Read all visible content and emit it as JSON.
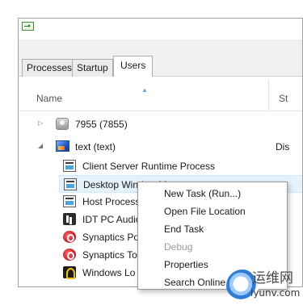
{
  "tabs": [
    {
      "label": "Processes"
    },
    {
      "label": "Startup"
    },
    {
      "label": "Users"
    }
  ],
  "columns": {
    "name": "Name",
    "status": "St"
  },
  "users": [
    {
      "label": "7955 (7855)",
      "expanded": false,
      "icon": "user-icon"
    },
    {
      "label": "text (text)",
      "expanded": true,
      "icon": "desktop-icon",
      "status": "Dis"
    }
  ],
  "processes": [
    {
      "label": "Client Server Runtime Process",
      "icon": "window-icon"
    },
    {
      "label": "Desktop Window M",
      "icon": "window-icon",
      "selected": true
    },
    {
      "label": "Host Process",
      "icon": "window-icon"
    },
    {
      "label": "IDT PC Audio",
      "icon": "audio-icon"
    },
    {
      "label": "Synaptics Po",
      "icon": "synaptics-icon"
    },
    {
      "label": "Synaptics To",
      "icon": "synaptics-icon"
    },
    {
      "label": "Windows Lo",
      "icon": "logon-icon"
    }
  ],
  "context_menu": {
    "items": [
      {
        "label": "New Task (Run...)",
        "enabled": true
      },
      {
        "label": "Open File Location",
        "enabled": true
      },
      {
        "label": "End Task",
        "enabled": true
      },
      {
        "label": "Debug",
        "enabled": false
      },
      {
        "label": "Properties",
        "enabled": true
      },
      {
        "label": "Search Online",
        "enabled": true
      }
    ]
  },
  "watermark": {
    "title": "运维网",
    "url": "iyunv.com"
  },
  "colors": {
    "selection": "#e5f1fb",
    "selection_border": "#cde8ff",
    "disabled_text": "#9a9a9a"
  }
}
